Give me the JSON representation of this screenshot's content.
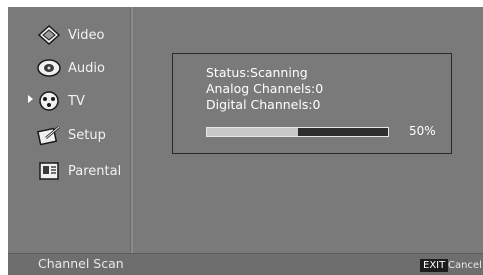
{
  "menu": {
    "items": [
      {
        "label": "Video",
        "icon": "video-icon"
      },
      {
        "label": "Audio",
        "icon": "audio-icon"
      },
      {
        "label": "TV",
        "icon": "tv-icon",
        "selected": true
      },
      {
        "label": "Setup",
        "icon": "setup-icon"
      },
      {
        "label": "Parental",
        "icon": "parental-icon"
      }
    ]
  },
  "scan": {
    "status": "Status:Scanning",
    "analog": "Analog Channels:0",
    "digital": "Digital Channels:0",
    "progress_fraction": 0.5,
    "progress_label": "50%"
  },
  "footer": {
    "title": "Channel Scan",
    "exit_key": "EXIT",
    "cancel_label": "Cancel"
  },
  "colors": {
    "background": "#7a7a7a",
    "text": "#ffffff",
    "progress_fill": "#c8c8c8",
    "progress_track": "#2e2e2e"
  }
}
